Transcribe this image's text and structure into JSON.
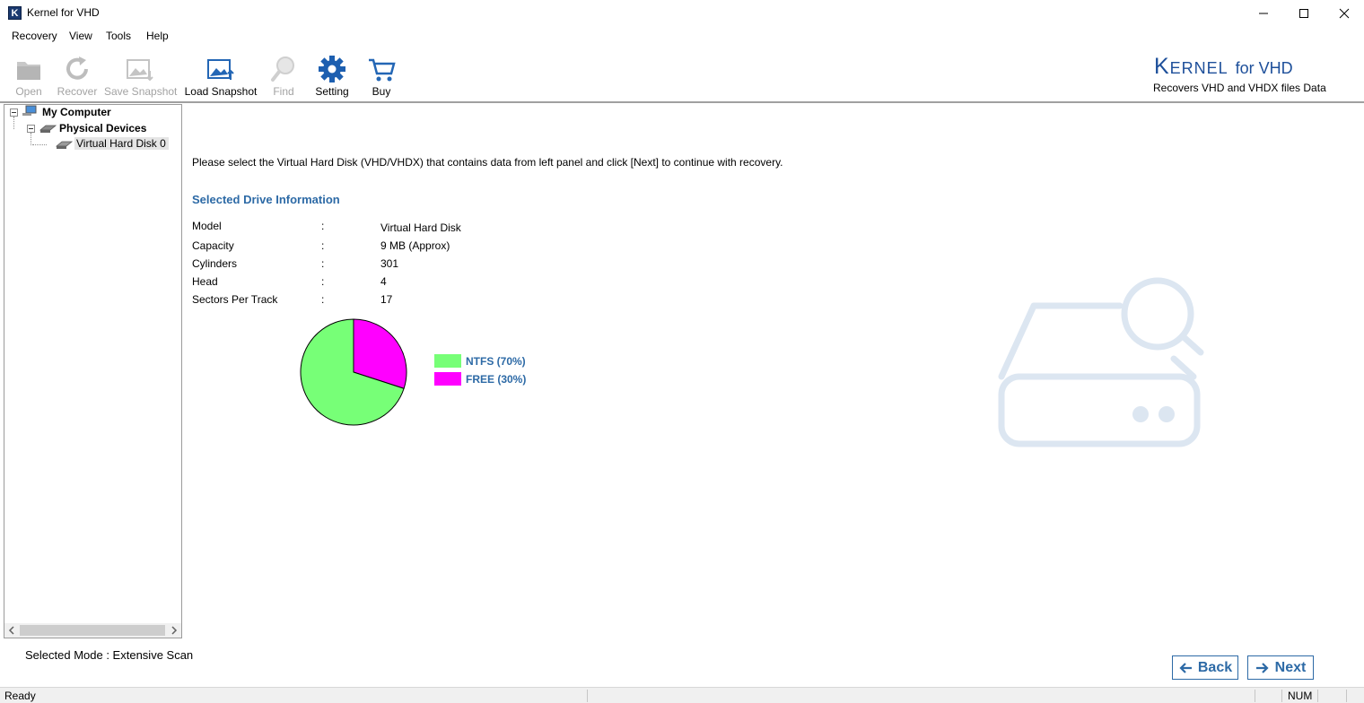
{
  "window": {
    "app_icon_letter": "K",
    "title": "Kernel for VHD"
  },
  "menu": [
    "Recovery",
    "View",
    "Tools",
    "Help"
  ],
  "toolbar": {
    "open": "Open",
    "recover": "Recover",
    "save_snapshot": "Save Snapshot",
    "load_snapshot": "Load Snapshot",
    "find": "Find",
    "setting": "Setting",
    "buy": "Buy"
  },
  "logo": {
    "brand": "Kernel",
    "product": "for VHD",
    "tagline": "Recovers VHD and VHDX files Data"
  },
  "tree": {
    "root": "My Computer",
    "group": "Physical Devices",
    "item": "Virtual Hard Disk 0"
  },
  "main": {
    "instruction": "Please select the Virtual Hard Disk (VHD/VHDX) that contains data from left panel and click [Next] to continue with recovery.",
    "section_title": "Selected Drive Information",
    "info": [
      {
        "label": "Model",
        "value": "Virtual Hard Disk"
      },
      {
        "label": "Capacity",
        "value": "9 MB (Approx)"
      },
      {
        "label": "Cylinders",
        "value": "301"
      },
      {
        "label": "Head",
        "value": "4"
      },
      {
        "label": "Sectors Per Track",
        "value": "17"
      }
    ],
    "separator": ":"
  },
  "chart_data": {
    "type": "pie",
    "slices": [
      {
        "label": "NTFS (70%)",
        "value": 70,
        "color": "#77ff77"
      },
      {
        "label": "FREE (30%)",
        "value": 30,
        "color": "#ff00ff"
      }
    ]
  },
  "footer": {
    "mode": "Selected Mode : Extensive Scan",
    "back": "Back",
    "next": "Next",
    "accent_color": "#2d6aa6"
  },
  "status": {
    "text": "Ready",
    "num": "NUM"
  }
}
